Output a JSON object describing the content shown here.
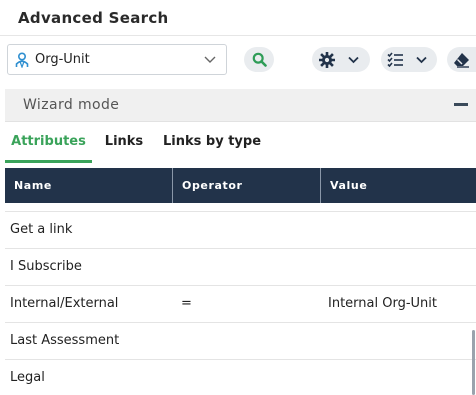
{
  "header": {
    "title": "Advanced Search"
  },
  "toolbar": {
    "scope_select": {
      "value": "Org-Unit",
      "icon": "person-icon"
    },
    "search_icon": "search-icon",
    "settings_icon": "gear-icon",
    "list_icon": "checklist-icon",
    "erase_icon": "eraser-icon"
  },
  "wizard": {
    "label": "Wizard mode",
    "collapse_icon": "minus-icon"
  },
  "tabs": [
    {
      "label": "Attributes",
      "active": true
    },
    {
      "label": "Links",
      "active": false
    },
    {
      "label": "Links by type",
      "active": false
    }
  ],
  "table": {
    "columns": [
      "Name",
      "Operator",
      "Value"
    ],
    "rows": [
      {
        "name": "",
        "operator": "",
        "value": ""
      },
      {
        "name": "Get a link",
        "operator": "",
        "value": ""
      },
      {
        "name": "I Subscribe",
        "operator": "",
        "value": ""
      },
      {
        "name": "Internal/External",
        "operator": "=",
        "value": "Internal Org-Unit"
      },
      {
        "name": "Last Assessment",
        "operator": "",
        "value": ""
      },
      {
        "name": "Legal",
        "operator": "",
        "value": ""
      }
    ]
  },
  "colors": {
    "accent": "#3aa35a",
    "header_bg": "#22334a",
    "search_icon": "#2e9c57"
  }
}
